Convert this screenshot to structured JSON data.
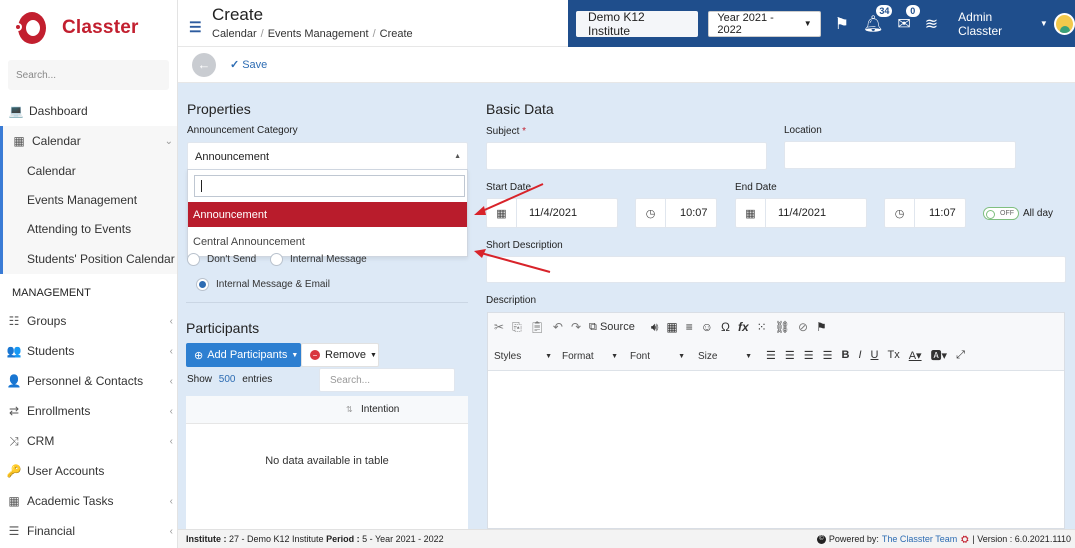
{
  "app": {
    "name": "Classter"
  },
  "sidebar": {
    "search_placeholder": "Search...",
    "items": [
      {
        "label": "Dashboard",
        "icon": "laptop-icon"
      },
      {
        "label": "Calendar",
        "icon": "calendar-icon"
      }
    ],
    "calendar_sub": [
      "Calendar",
      "Events Management",
      "Attending to Events",
      "Students' Position Calendar"
    ],
    "section_label": "MANAGEMENT",
    "management_items": [
      "Groups",
      "Students",
      "Personnel & Contacts",
      "Enrollments",
      "CRM",
      "User Accounts",
      "Academic Tasks",
      "Financial"
    ]
  },
  "header": {
    "title": "Create",
    "breadcrumb": [
      "Calendar",
      "Events Management",
      "Create"
    ],
    "institute": "Demo K12 Institute",
    "year": "Year 2021 - 2022",
    "notifications_count": "34",
    "messages_count": "0",
    "user": "Admin Classter"
  },
  "toolbar": {
    "save_label": "Save"
  },
  "properties": {
    "title": "Properties",
    "category_label": "Announcement Category",
    "category_value": "Announcement",
    "options": [
      "Announcement",
      "Central Announcement"
    ],
    "radio_dont_send": "Don't Send",
    "radio_internal": "Internal Message",
    "radio_internal_email": "Internal Message & Email"
  },
  "participants": {
    "title": "Participants",
    "add_label": "Add Participants",
    "remove_label": "Remove",
    "show_label": "Show",
    "show_count": "500",
    "entries_label": "entries",
    "search_placeholder": "Search...",
    "col_intention": "Intention",
    "empty_text": "No data available in table"
  },
  "basic": {
    "title": "Basic Data",
    "subject_label": "Subject",
    "location_label": "Location",
    "start_label": "Start Date",
    "start_date": "11/4/2021",
    "start_time": "10:07",
    "end_label": "End Date",
    "end_date": "11/4/2021",
    "end_time": "11:07",
    "toggle_state": "OFF",
    "allday_label": "All day",
    "short_desc_label": "Short Description",
    "desc_label": "Description"
  },
  "editor": {
    "source_label": "Source",
    "styles": "Styles",
    "format": "Format",
    "font": "Font",
    "size": "Size"
  },
  "footer": {
    "institute_label": "Institute :",
    "institute_value": "27 - Demo K12 Institute",
    "period_label": "Period :",
    "period_value": "5 - Year 2021 - 2022",
    "powered": "Powered by:",
    "team": "The Classter Team",
    "version": "| Version : 6.0.2021.1110"
  },
  "colors": {
    "brand": "#c21f2f",
    "header": "#1f4e8c",
    "accent": "#2d7fd1",
    "panel": "#dde9f6"
  }
}
